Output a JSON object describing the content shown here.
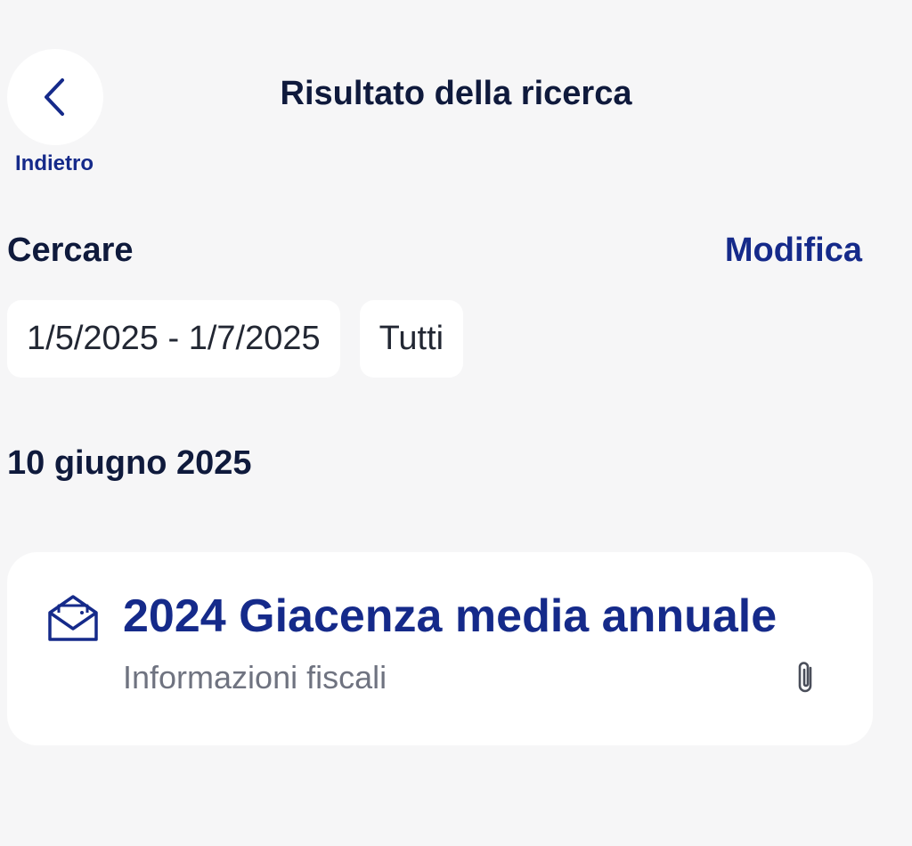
{
  "header": {
    "back_label": "Indietro",
    "title": "Risultato della ricerca"
  },
  "search": {
    "label": "Cercare",
    "edit_label": "Modifica",
    "filters": [
      "1/5/2025 - 1/7/2025",
      "Tutti"
    ]
  },
  "results": {
    "date_heading": "10 giugno 2025",
    "items": [
      {
        "title": "2024 Giacenza media annuale",
        "subtitle": "Informazioni fiscali",
        "icon": "envelope-open-icon",
        "attachment_icon": "paperclip-icon"
      }
    ]
  },
  "colors": {
    "background": "#f6f6f7",
    "accent": "#152a8a",
    "text": "#0f1a3c",
    "muted": "#6f7380"
  }
}
